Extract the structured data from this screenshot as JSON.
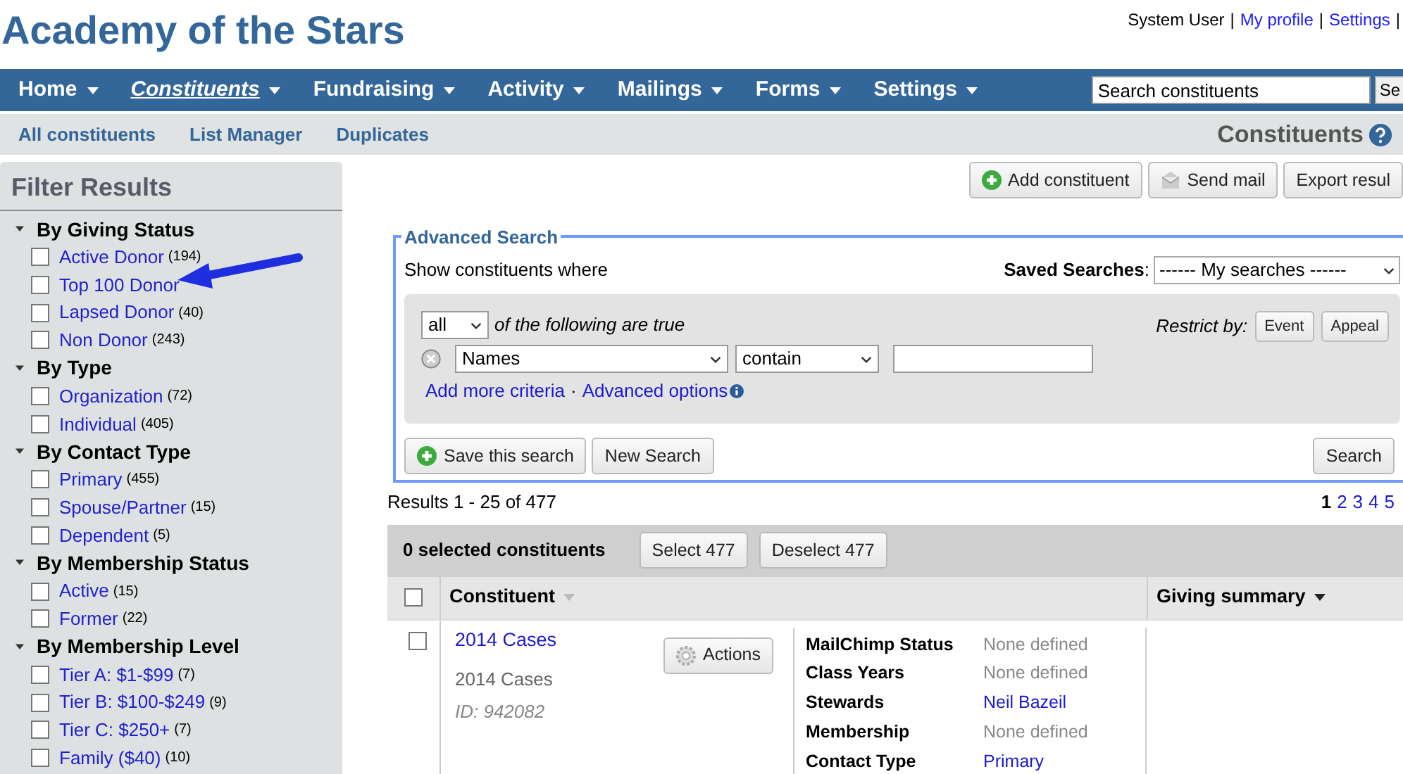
{
  "header": {
    "title": "Academy of the Stars",
    "user_menu": [
      {
        "kind": "text",
        "label": "System User"
      },
      {
        "kind": "separator",
        "label": "|"
      },
      {
        "kind": "link",
        "label": "My profile"
      },
      {
        "kind": "separator",
        "label": "|"
      },
      {
        "kind": "link",
        "label": "Settings"
      },
      {
        "kind": "separator",
        "label": "|"
      }
    ]
  },
  "nav": {
    "items": [
      {
        "label": "Home",
        "selected": false
      },
      {
        "label": "Constituents",
        "selected": true
      },
      {
        "label": "Fundraising",
        "selected": false
      },
      {
        "label": "Activity",
        "selected": false
      },
      {
        "label": "Mailings",
        "selected": false
      },
      {
        "label": "Forms",
        "selected": false
      },
      {
        "label": "Settings",
        "selected": false
      }
    ],
    "search": {
      "value": "Search constituents"
    },
    "search_button": "Se"
  },
  "subnav": {
    "links": [
      "All constituents",
      "List Manager",
      "Duplicates"
    ],
    "page_title": "Constituents"
  },
  "filters": {
    "title": "Filter Results",
    "groups": [
      {
        "title": "By Giving Status",
        "expanded": true,
        "items": [
          {
            "label": "Active Donor",
            "count": "(194)",
            "checked": false
          },
          {
            "label": "Top 100 Donor",
            "checked": false
          },
          {
            "label": "Lapsed Donor",
            "count": "(40)",
            "checked": false
          },
          {
            "label": "Non Donor",
            "count": "(243)",
            "checked": false
          }
        ]
      },
      {
        "title": "By Type",
        "expanded": true,
        "items": [
          {
            "label": "Organization",
            "count": "(72)",
            "checked": false
          },
          {
            "label": "Individual",
            "count": "(405)",
            "checked": false
          }
        ]
      },
      {
        "title": "By Contact Type",
        "expanded": true,
        "items": [
          {
            "label": "Primary",
            "count": "(455)",
            "checked": false
          },
          {
            "label": "Spouse/Partner",
            "count": "(15)",
            "checked": false
          },
          {
            "label": "Dependent",
            "count": "(5)",
            "checked": false
          }
        ]
      },
      {
        "title": "By Membership Status",
        "expanded": true,
        "items": [
          {
            "label": "Active",
            "count": "(15)",
            "checked": false
          },
          {
            "label": "Former",
            "count": "(22)",
            "checked": false
          }
        ]
      },
      {
        "title": "By Membership Level",
        "expanded": true,
        "items": [
          {
            "label": "Tier A: $1-$99",
            "count": "(7)",
            "checked": false
          },
          {
            "label": "Tier B: $100-$249",
            "count": "(9)",
            "checked": false
          },
          {
            "label": "Tier C: $250+",
            "count": "(7)",
            "checked": false
          },
          {
            "label": "Family ($40)",
            "count": "(10)",
            "checked": false
          }
        ]
      }
    ]
  },
  "toolbar": [
    {
      "label": "Add constituent"
    },
    {
      "label": "Send mail"
    },
    {
      "label": "Export resul"
    }
  ],
  "advanced_search": {
    "legend": "Advanced Search",
    "intro": "Show constituents where",
    "saved_searches": {
      "label": "**Saved Searches**:",
      "value": "------ My searches ------"
    },
    "match": {
      "value": "all",
      "text": "of the following are true"
    },
    "restrict": {
      "label": "Restrict by:",
      "buttons": [
        "Event",
        "Appeal"
      ]
    },
    "criteria": [
      {
        "field": "Names",
        "operator": "contain"
      }
    ],
    "links": [
      "Add more criteria",
      "Advanced options"
    ],
    "link_separator": "·",
    "buttons": [
      {
        "label": "Save this search"
      },
      {
        "label": "New Search"
      }
    ],
    "search_button": "Search"
  },
  "results": {
    "summary": "Results 1 - 25 of 477",
    "pages": [
      {
        "label": "1",
        "selected": true
      },
      {
        "label": "2",
        "selected": false
      },
      {
        "label": "3",
        "selected": false
      },
      {
        "label": "4",
        "selected": false
      },
      {
        "label": "5",
        "selected": false
      }
    ]
  },
  "selection": {
    "text": "0 selected constituents",
    "buttons": [
      "Select 477",
      "Deselect 477"
    ]
  },
  "table": {
    "header_checked": false,
    "columns": [
      {
        "label": "Constituent",
        "sort_active": false
      },
      {
        "label": "Giving summary",
        "sort_active": true
      }
    ],
    "rows": [
      {
        "checked": false,
        "name": "2014 Cases",
        "subtitle": "2014 Cases",
        "id": "ID: 942082",
        "action": "Actions",
        "details": [
          {
            "label": "MailChimp Status",
            "value": "None defined",
            "kind": "text"
          },
          {
            "label": "Class Years",
            "value": "None defined",
            "kind": "text"
          },
          {
            "label": "Stewards",
            "value": "Neil Bazeil",
            "kind": "link"
          },
          {
            "label": "Membership",
            "value": "None defined",
            "kind": "text"
          },
          {
            "label": "Contact Type",
            "value": "Primary",
            "kind": "link"
          }
        ]
      }
    ]
  }
}
